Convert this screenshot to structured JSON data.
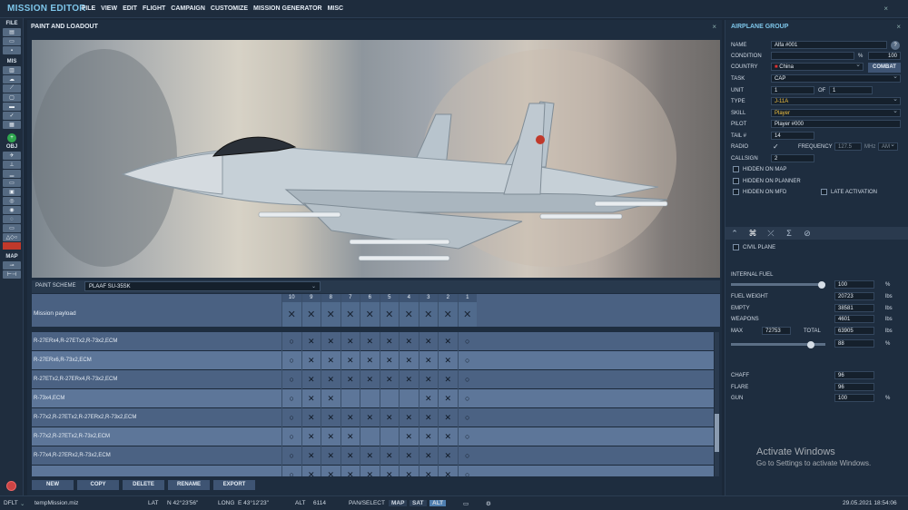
{
  "app": {
    "title": "MISSION EDITOR",
    "menu": [
      "FILE",
      "VIEW",
      "EDIT",
      "FLIGHT",
      "CAMPAIGN",
      "CUSTOMIZE",
      "MISSION GENERATOR",
      "MISC"
    ],
    "close": "×"
  },
  "toolbar": {
    "file": "FILE",
    "mis": "MIS",
    "obj": "OBJ",
    "map": "MAP"
  },
  "panel": {
    "title": "PAINT AND LOADOUT",
    "close": "×",
    "paint_scheme_label": "PAINT SCHEME",
    "paint_scheme_value": "PLAAF SU-35SK",
    "stations": [
      "10",
      "9",
      "8",
      "7",
      "6",
      "5",
      "4",
      "3",
      "2",
      "1"
    ],
    "mission_payload_label": "Mission payload",
    "mission_payload_row": [
      "✕",
      "✕",
      "✕",
      "✕",
      "✕",
      "✕",
      "✕",
      "✕",
      "✕",
      "✕"
    ],
    "loadouts": [
      {
        "name": "R-27ERx4,R-27ETx2,R-73x2,ECM",
        "cells": [
          "○",
          "✕",
          "✕",
          "✕",
          "✕",
          "✕",
          "✕",
          "✕",
          "✕",
          "○"
        ]
      },
      {
        "name": "R-27ERx6,R-73x2,ECM",
        "cells": [
          "○",
          "✕",
          "✕",
          "✕",
          "✕",
          "✕",
          "✕",
          "✕",
          "✕",
          "○"
        ]
      },
      {
        "name": "R-27ETx2,R-27ERx4,R-73x2,ECM",
        "cells": [
          "○",
          "✕",
          "✕",
          "✕",
          "✕",
          "✕",
          "✕",
          "✕",
          "✕",
          "○"
        ]
      },
      {
        "name": "R-73x4,ECM",
        "cells": [
          "○",
          "✕",
          "✕",
          "",
          "",
          "",
          "",
          "✕",
          "✕",
          "○"
        ]
      },
      {
        "name": "R-77x2,R-27ETx2,R-27ERx2,R-73x2,ECM",
        "cells": [
          "○",
          "✕",
          "✕",
          "✕",
          "✕",
          "✕",
          "✕",
          "✕",
          "✕",
          "○"
        ]
      },
      {
        "name": "R-77x2,R-27ETx2,R-73x2,ECM",
        "cells": [
          "○",
          "✕",
          "✕",
          "✕",
          "",
          "",
          "✕",
          "✕",
          "✕",
          "○"
        ]
      },
      {
        "name": "R-77x4,R-27ERx2,R-73x2,ECM",
        "cells": [
          "○",
          "✕",
          "✕",
          "✕",
          "✕",
          "✕",
          "✕",
          "✕",
          "✕",
          "○"
        ]
      },
      {
        "name": "",
        "cells": [
          "○",
          "✕",
          "✕",
          "✕",
          "✕",
          "✕",
          "✕",
          "✕",
          "✕",
          "○"
        ]
      }
    ],
    "buttons": {
      "new": "NEW",
      "copy": "COPY",
      "delete": "DELETE",
      "rename": "RENAME",
      "export": "EXPORT"
    }
  },
  "group": {
    "title": "AIRPLANE GROUP",
    "close": "×",
    "name_label": "NAME",
    "name_value": "Alfa #001",
    "help": "?",
    "condition_label": "CONDITION",
    "condition_unit": "%",
    "condition_value": "100",
    "country_label": "COUNTRY",
    "country_value": "China",
    "combat_button": "COMBAT",
    "task_label": "TASK",
    "task_value": "CAP",
    "unit_label": "UNIT",
    "unit_value": "1",
    "of_label": "OF",
    "of_value": "1",
    "type_label": "TYPE",
    "type_value": "J-11A",
    "skill_label": "SKILL",
    "skill_value": "Player",
    "pilot_label": "PILOT",
    "pilot_value": "Player #000",
    "tail_label": "TAIL #",
    "tail_value": "14",
    "radio_label": "RADIO",
    "frequency_label": "FREQUENCY",
    "frequency_value": "127.5",
    "mhz": "MHz",
    "am": "AM",
    "callsign_label": "CALLSIGN",
    "callsign_value": "2",
    "hidden_map": "HIDDEN ON MAP",
    "hidden_planner": "HIDDEN ON PLANNER",
    "hidden_mfd": "HIDDEN ON MFD",
    "late_activation": "LATE ACTIVATION",
    "civil_plane": "CIVIL PLANE",
    "internal_fuel_label": "INTERNAL FUEL",
    "fuel_value": "100",
    "fuel_unit": "%",
    "fuel_level": 1.0,
    "fuel_weight_label": "FUEL WEIGHT",
    "fuel_weight": "20723",
    "lbs": "lbs",
    "empty_label": "EMPTY",
    "empty": "38581",
    "weapons_label": "WEAPONS",
    "weapons": "4601",
    "max_label": "MAX",
    "max": "72753",
    "total_label": "TOTAL",
    "total": "63905",
    "weight_pct": "88",
    "weight_level": 0.88,
    "chaff_label": "CHAFF",
    "chaff": "96",
    "flare_label": "FLARE",
    "flare": "96",
    "gun_label": "GUN",
    "gun": "100",
    "gun_unit": "%"
  },
  "activate": {
    "line1": "Activate Windows",
    "line2": "Go to Settings to activate Windows."
  },
  "status": {
    "mode": "DFLT",
    "file": "tempMission.miz",
    "lat_label": "LAT",
    "lat": "N 42°23'56\"",
    "long_label": "LONG",
    "long": "E 43°12'23\"",
    "alt_label": "ALT",
    "alt": "6114",
    "pan": "PAN/SELECT",
    "map": "MAP",
    "sat": "SAT",
    "alt2": "ALT",
    "datetime": "29.05.2021 18:54:06"
  }
}
